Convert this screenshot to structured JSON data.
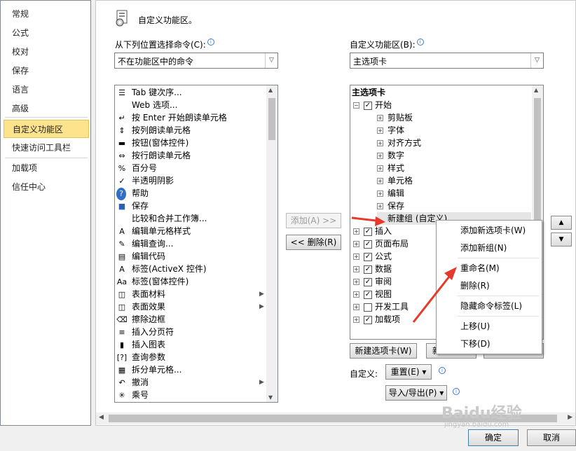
{
  "nav": {
    "items": [
      "常规",
      "公式",
      "校对",
      "保存",
      "语言",
      "高级",
      "自定义功能区",
      "快速访问工具栏",
      "加载项",
      "信任中心"
    ],
    "active": "自定义功能区"
  },
  "header": {
    "title": "自定义功能区。"
  },
  "left": {
    "label": "从下列位置选择命令(C):",
    "combo_value": "不在功能区中的命令",
    "commands": [
      {
        "icon": "tab-order-icon",
        "text": "Tab 键次序..."
      },
      {
        "icon": "none",
        "text": "Web 选项..."
      },
      {
        "icon": "speak-on-enter-icon",
        "text": "按 Enter 开始朗读单元格"
      },
      {
        "icon": "speak-by-columns-icon",
        "text": "按列朗读单元格"
      },
      {
        "icon": "form-button-icon",
        "text": "按钮(窗体控件)"
      },
      {
        "icon": "speak-by-rows-icon",
        "text": "按行朗读单元格"
      },
      {
        "icon": "percent-icon",
        "text": "百分号"
      },
      {
        "icon": "check-icon",
        "text": "半透明阴影"
      },
      {
        "icon": "help-icon",
        "text": "帮助"
      },
      {
        "icon": "save-icon",
        "text": "保存"
      },
      {
        "icon": "none",
        "text": "比较和合并工作簿..."
      },
      {
        "icon": "cell-style-icon",
        "text": "编辑单元格样式"
      },
      {
        "icon": "edit-query-icon",
        "text": "编辑查询..."
      },
      {
        "icon": "edit-code-icon",
        "text": "编辑代码"
      },
      {
        "icon": "activex-label-icon",
        "text": "标签(ActiveX 控件)"
      },
      {
        "icon": "form-label-icon",
        "text": "标签(窗体控件)"
      },
      {
        "icon": "surface-material-icon",
        "text": "表面材料",
        "submenu": true
      },
      {
        "icon": "surface-effect-icon",
        "text": "表面效果",
        "submenu": true
      },
      {
        "icon": "erase-border-icon",
        "text": "擦除边框"
      },
      {
        "icon": "page-break-icon",
        "text": "插入分页符"
      },
      {
        "icon": "insert-chart-icon",
        "text": "插入图表"
      },
      {
        "icon": "query-params-icon",
        "text": "查询参数"
      },
      {
        "icon": "split-cells-icon",
        "text": "拆分单元格..."
      },
      {
        "icon": "undo-icon",
        "text": "撤消",
        "submenu": true
      },
      {
        "icon": "multiply-icon",
        "text": "乘号"
      }
    ]
  },
  "right": {
    "label": "自定义功能区(B):",
    "combo_value": "主选项卡",
    "tree_header": "主选项卡",
    "tree": [
      {
        "level": 0,
        "expander": "⊟",
        "checked": true,
        "text": "开始"
      },
      {
        "level": 1,
        "expander": "⊞",
        "checked": null,
        "text": "剪贴板"
      },
      {
        "level": 1,
        "expander": "⊞",
        "checked": null,
        "text": "字体"
      },
      {
        "level": 1,
        "expander": "⊞",
        "checked": null,
        "text": "对齐方式"
      },
      {
        "level": 1,
        "expander": "⊞",
        "checked": null,
        "text": "数字"
      },
      {
        "level": 1,
        "expander": "⊞",
        "checked": null,
        "text": "样式"
      },
      {
        "level": 1,
        "expander": "⊞",
        "checked": null,
        "text": "单元格"
      },
      {
        "level": 1,
        "expander": "⊞",
        "checked": null,
        "text": "编辑"
      },
      {
        "level": 1,
        "expander": "⊞",
        "checked": null,
        "text": "保存"
      },
      {
        "level": 1,
        "expander": "",
        "checked": null,
        "text": "新建组 (自定义)",
        "selected": true
      },
      {
        "level": 0,
        "expander": "⊞",
        "checked": true,
        "text": "插入"
      },
      {
        "level": 0,
        "expander": "⊞",
        "checked": true,
        "text": "页面布局"
      },
      {
        "level": 0,
        "expander": "⊞",
        "checked": true,
        "text": "公式"
      },
      {
        "level": 0,
        "expander": "⊞",
        "checked": true,
        "text": "数据"
      },
      {
        "level": 0,
        "expander": "⊞",
        "checked": true,
        "text": "审阅"
      },
      {
        "level": 0,
        "expander": "⊞",
        "checked": true,
        "text": "视图"
      },
      {
        "level": 0,
        "expander": "⊞",
        "checked": false,
        "text": "开发工具"
      },
      {
        "level": 0,
        "expander": "⊞",
        "checked": true,
        "text": "加载项"
      }
    ]
  },
  "buttons": {
    "add": "添加(A) >>",
    "remove": "<< 删除(R)",
    "new_tab": "新建选项卡(W)",
    "new_group_partial": "新",
    "rename_partial": "重",
    "customize_label": "自定义:",
    "reset": "重置(E) ▾",
    "import_export": "导入/导出(P) ▾",
    "ok": "确定",
    "cancel": "取消",
    "move_up": "▲",
    "move_down": "▼"
  },
  "context_menu": {
    "items": [
      "添加新选项卡(W)",
      "添加新组(N)",
      "重命名(M)",
      "删除(R)",
      "隐藏命令标签(L)",
      "上移(U)",
      "下移(D)"
    ]
  },
  "watermark": {
    "line1": "Baidu经验",
    "line2": "jingyan.baidu.com"
  },
  "colors": {
    "active_nav": "#fde38b",
    "selected_row": "#e5e5e5",
    "arrow_red": "#e53a2b"
  }
}
